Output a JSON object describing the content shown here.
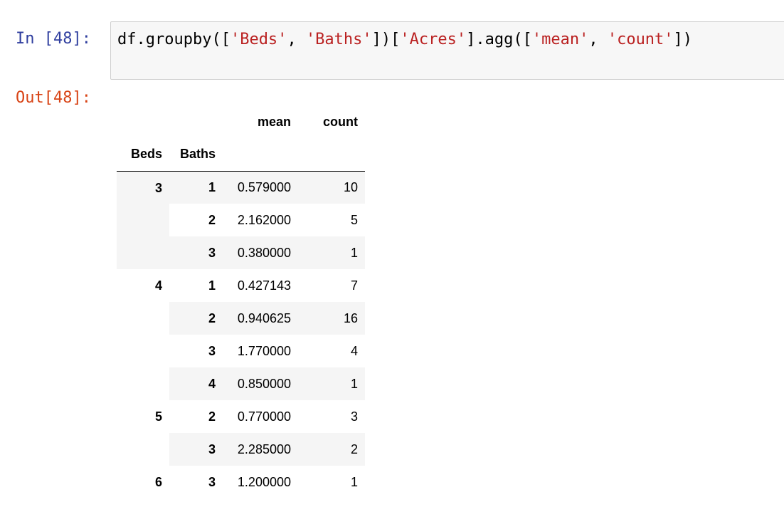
{
  "input": {
    "prompt": "In [48]:",
    "code_tokens": [
      {
        "t": "df.groupby([",
        "c": "plain"
      },
      {
        "t": "'Beds'",
        "c": "str"
      },
      {
        "t": ", ",
        "c": "plain"
      },
      {
        "t": "'Baths'",
        "c": "str"
      },
      {
        "t": "])[",
        "c": "plain"
      },
      {
        "t": "'Acres'",
        "c": "str"
      },
      {
        "t": "].agg([",
        "c": "plain"
      },
      {
        "t": "'mean'",
        "c": "str"
      },
      {
        "t": ", ",
        "c": "plain"
      },
      {
        "t": "'count'",
        "c": "str"
      },
      {
        "t": "])",
        "c": "plain"
      }
    ]
  },
  "output": {
    "prompt": "Out[48]:",
    "table": {
      "columns": [
        "mean",
        "count"
      ],
      "index_names": [
        "Beds",
        "Baths"
      ],
      "groups": [
        {
          "beds": "3",
          "rows": [
            {
              "baths": "1",
              "mean": "0.579000",
              "count": "10"
            },
            {
              "baths": "2",
              "mean": "2.162000",
              "count": "5"
            },
            {
              "baths": "3",
              "mean": "0.380000",
              "count": "1"
            }
          ]
        },
        {
          "beds": "4",
          "rows": [
            {
              "baths": "1",
              "mean": "0.427143",
              "count": "7"
            },
            {
              "baths": "2",
              "mean": "0.940625",
              "count": "16"
            },
            {
              "baths": "3",
              "mean": "1.770000",
              "count": "4"
            },
            {
              "baths": "4",
              "mean": "0.850000",
              "count": "1"
            }
          ]
        },
        {
          "beds": "5",
          "rows": [
            {
              "baths": "2",
              "mean": "0.770000",
              "count": "3"
            },
            {
              "baths": "3",
              "mean": "2.285000",
              "count": "2"
            }
          ]
        },
        {
          "beds": "6",
          "rows": [
            {
              "baths": "3",
              "mean": "1.200000",
              "count": "1"
            }
          ]
        }
      ]
    }
  },
  "colors": {
    "in_prompt": "#303f9f",
    "out_prompt": "#d84315",
    "string_literal": "#ba2121",
    "stripe_bg": "#f5f5f5"
  }
}
